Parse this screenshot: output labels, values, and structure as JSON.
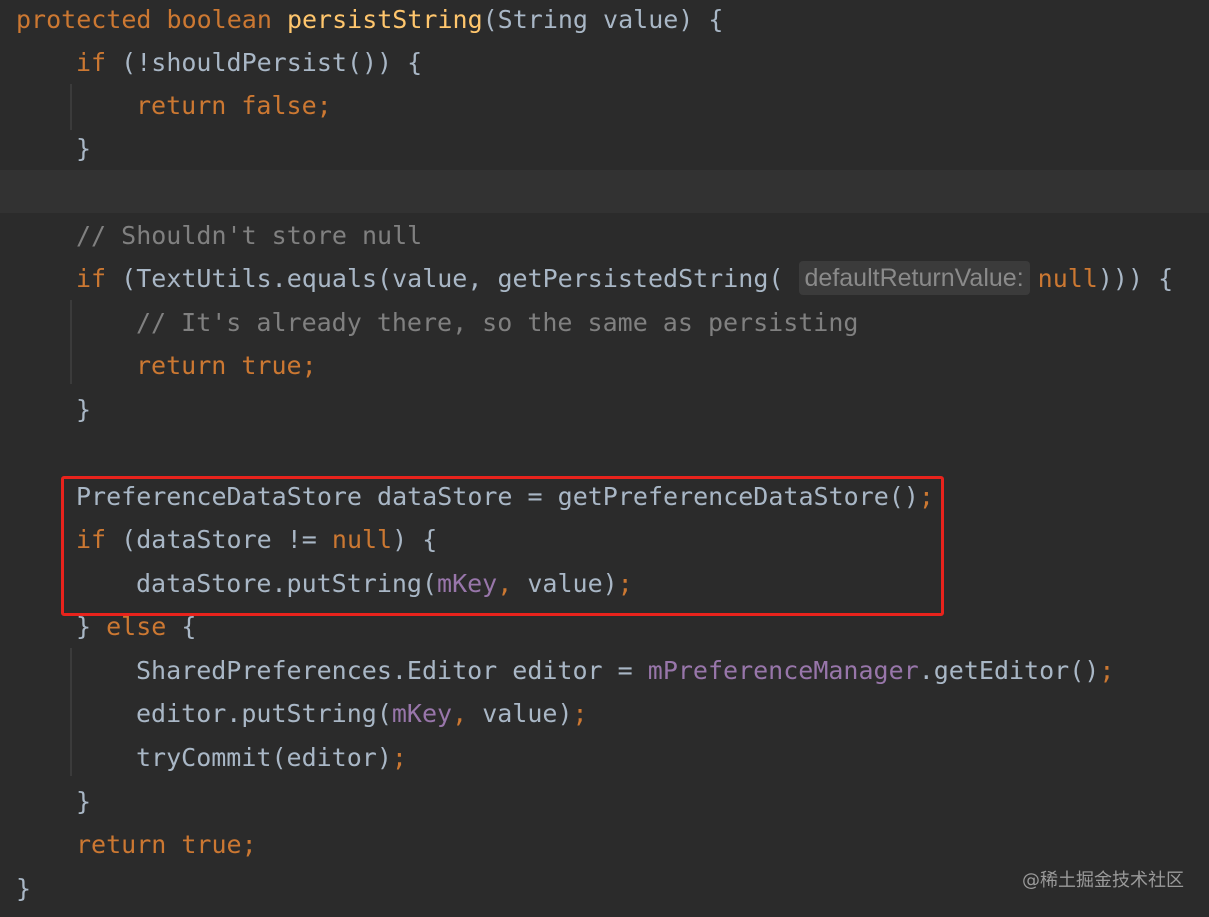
{
  "editor": {
    "colors": {
      "background": "#2b2b2b",
      "keyword": "#cc7832",
      "method": "#ffc66d",
      "comment": "#808080",
      "field": "#9876aa",
      "text": "#a9b7c6",
      "highlight_box": "#e8231c"
    },
    "l01": {
      "protected": "protected",
      "boolean": "boolean",
      "name": "persistString",
      "params": "(String value) {"
    },
    "l02": {
      "if": "if",
      "cond": "(!shouldPersist()) {"
    },
    "l03": {
      "return": "return",
      "false": "false",
      "semi": ";"
    },
    "l04": {
      "brace": "}"
    },
    "l06": {
      "comment": "// Shouldn't store null"
    },
    "l07": {
      "if": "if",
      "pre": "(TextUtils.equals(value,",
      "call": "getPersistedString(",
      "hint": "defaultReturnValue:",
      "null": "null",
      "post": "))) {"
    },
    "l08": {
      "comment": "// It's already there, so the same as persisting"
    },
    "l09": {
      "return": "return",
      "true": "true",
      "semi": ";"
    },
    "l10": {
      "brace": "}"
    },
    "l12": {
      "text": "PreferenceDataStore dataStore = getPreferenceDataStore()",
      "semi": ";"
    },
    "l13": {
      "if": "if",
      "pre": "(dataStore !=",
      "null": "null",
      "post": ") {"
    },
    "l14": {
      "pre": "dataStore.putString(",
      "field": "mKey",
      "comma": ",",
      "post": " value)",
      "semi": ";"
    },
    "l15": {
      "brace": "}",
      "else": "else",
      "open": "{"
    },
    "l16": {
      "pre": "SharedPreferences.Editor editor =",
      "field": "mPreferenceManager",
      "post": ".getEditor()",
      "semi": ";"
    },
    "l17": {
      "pre": "editor.putString(",
      "field": "mKey",
      "comma": ",",
      "post": " value)",
      "semi": ";"
    },
    "l18": {
      "text": "tryCommit(editor)",
      "semi": ";"
    },
    "l19": {
      "brace": "}"
    },
    "l20": {
      "return": "return",
      "true": "true",
      "semi": ";"
    },
    "l21": {
      "brace": "}"
    }
  },
  "watermark": "@稀土掘金技术社区"
}
